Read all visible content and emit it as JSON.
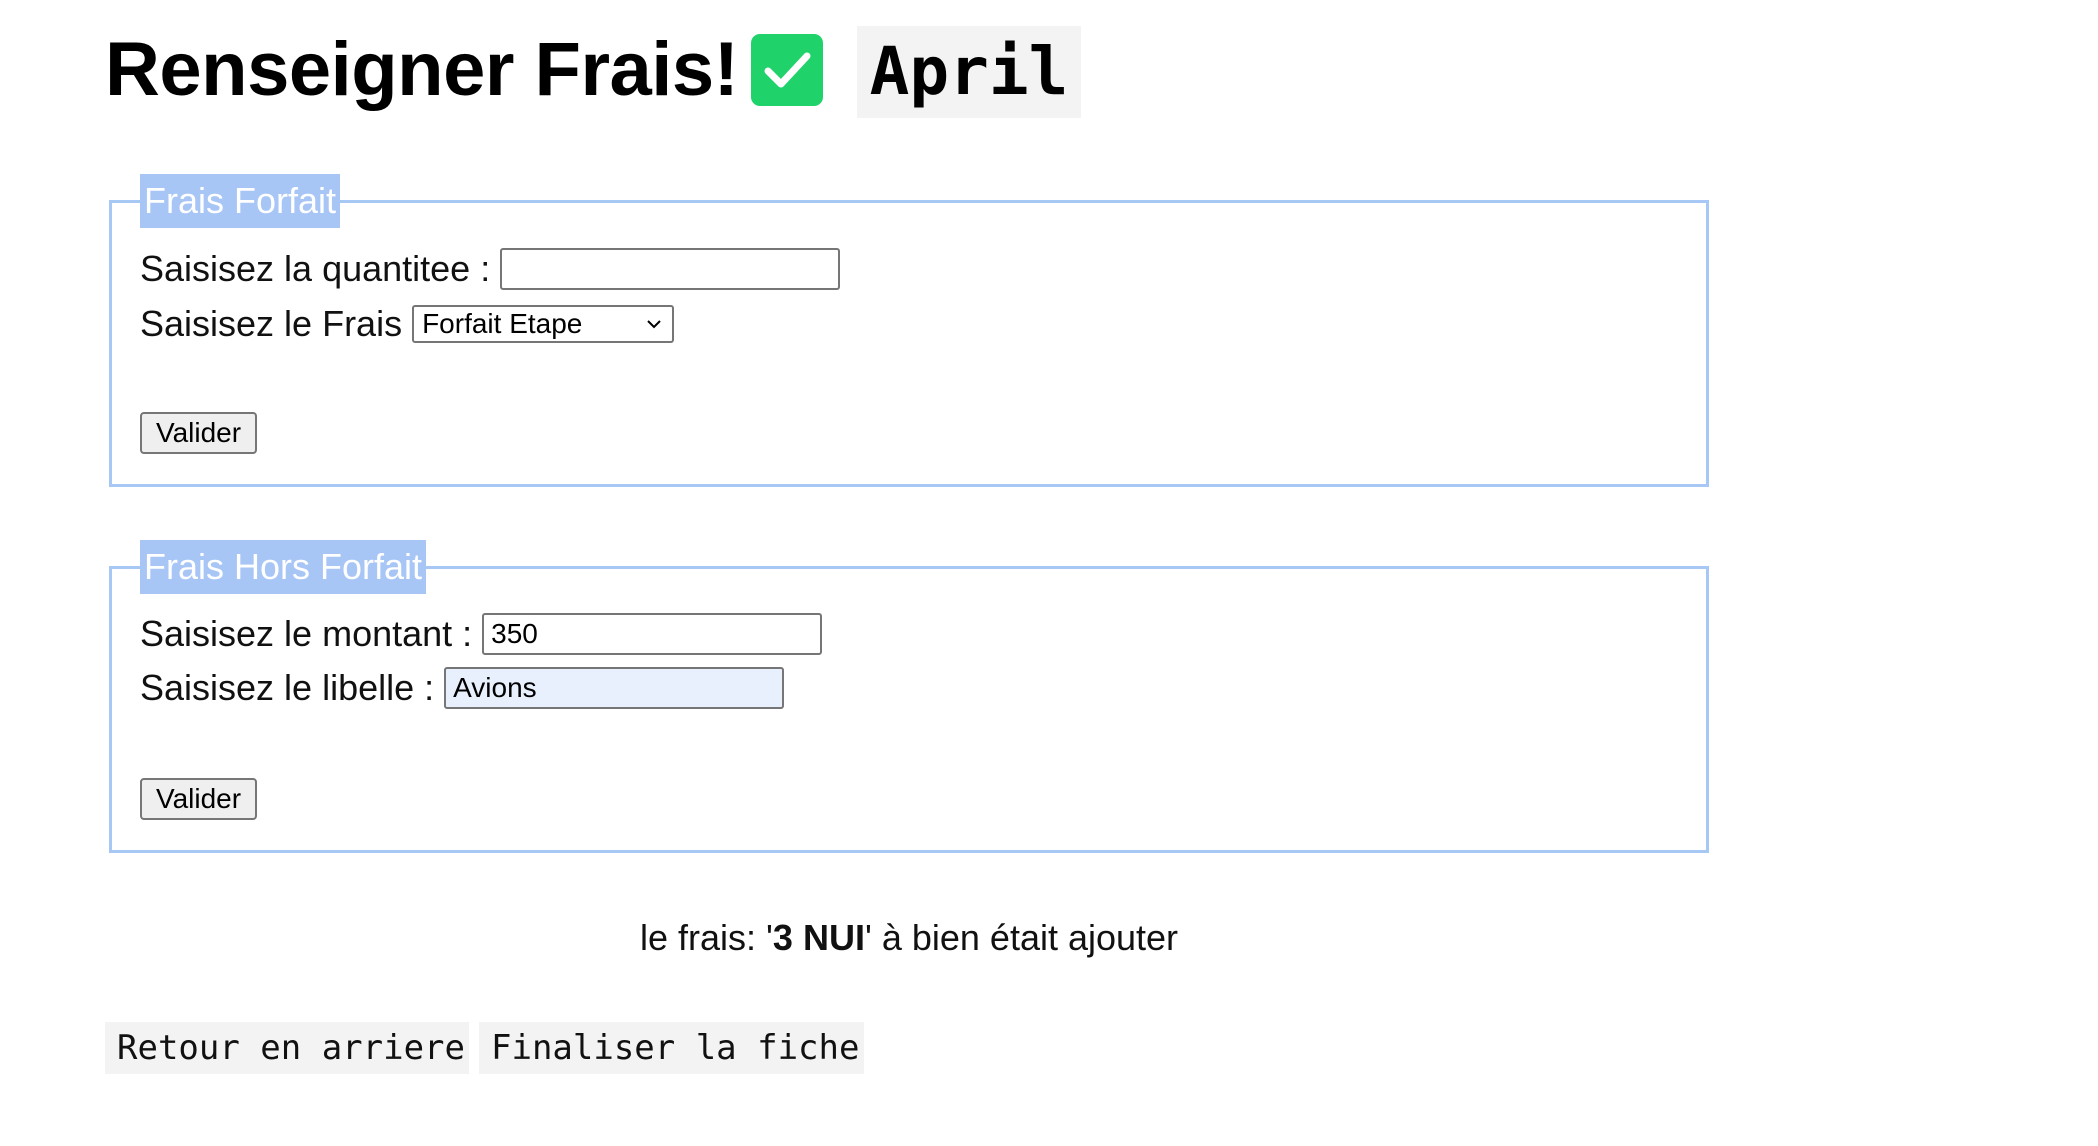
{
  "header": {
    "title": "Renseigner Frais!",
    "check_icon_color": "#1fd26a",
    "month": "April"
  },
  "frais_forfait": {
    "legend": "Frais Forfait",
    "quantite_label": "Saisisez la quantitee :",
    "quantite_value": "",
    "frais_label": "Saisisez le Frais",
    "frais_selected": "Forfait Etape",
    "submit_label": "Valider"
  },
  "frais_hors_forfait": {
    "legend": "Frais Hors Forfait",
    "montant_label": "Saisisez le montant :",
    "montant_value": "350",
    "libelle_label": "Saisisez le libelle :",
    "libelle_value": "Avions",
    "submit_label": "Valider"
  },
  "status_message": {
    "prefix": "le frais: '",
    "highlight": "3 NUI",
    "suffix": "' à bien était ajouter"
  },
  "footer": {
    "back_label": "Retour en arriere",
    "finalize_label": "Finaliser la fiche"
  },
  "colors": {
    "legend_bg": "#a7c6f5",
    "fieldset_border": "#a7c7f5",
    "autofill_bg": "#e8f0fe"
  }
}
